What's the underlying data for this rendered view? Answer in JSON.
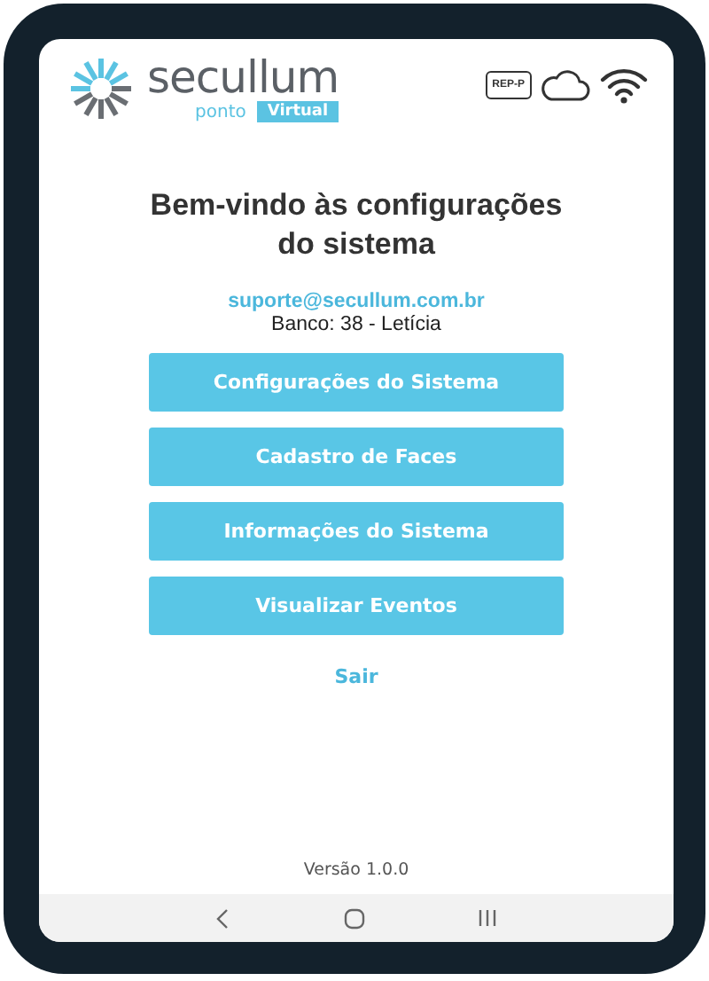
{
  "logo": {
    "brand": "secullum",
    "product": "ponto",
    "badge": "Virtual"
  },
  "status_icons": {
    "rep_label": "REP-P"
  },
  "title": "Bem-vindo às configurações do sistema",
  "email": "suporte@secullum.com.br",
  "database": "Banco: 38 - Letícia",
  "buttons": [
    "Configurações do Sistema",
    "Cadastro de Faces",
    "Informações do Sistema",
    "Visualizar Eventos"
  ],
  "logout": "Sair",
  "version": "Versão 1.0.0"
}
